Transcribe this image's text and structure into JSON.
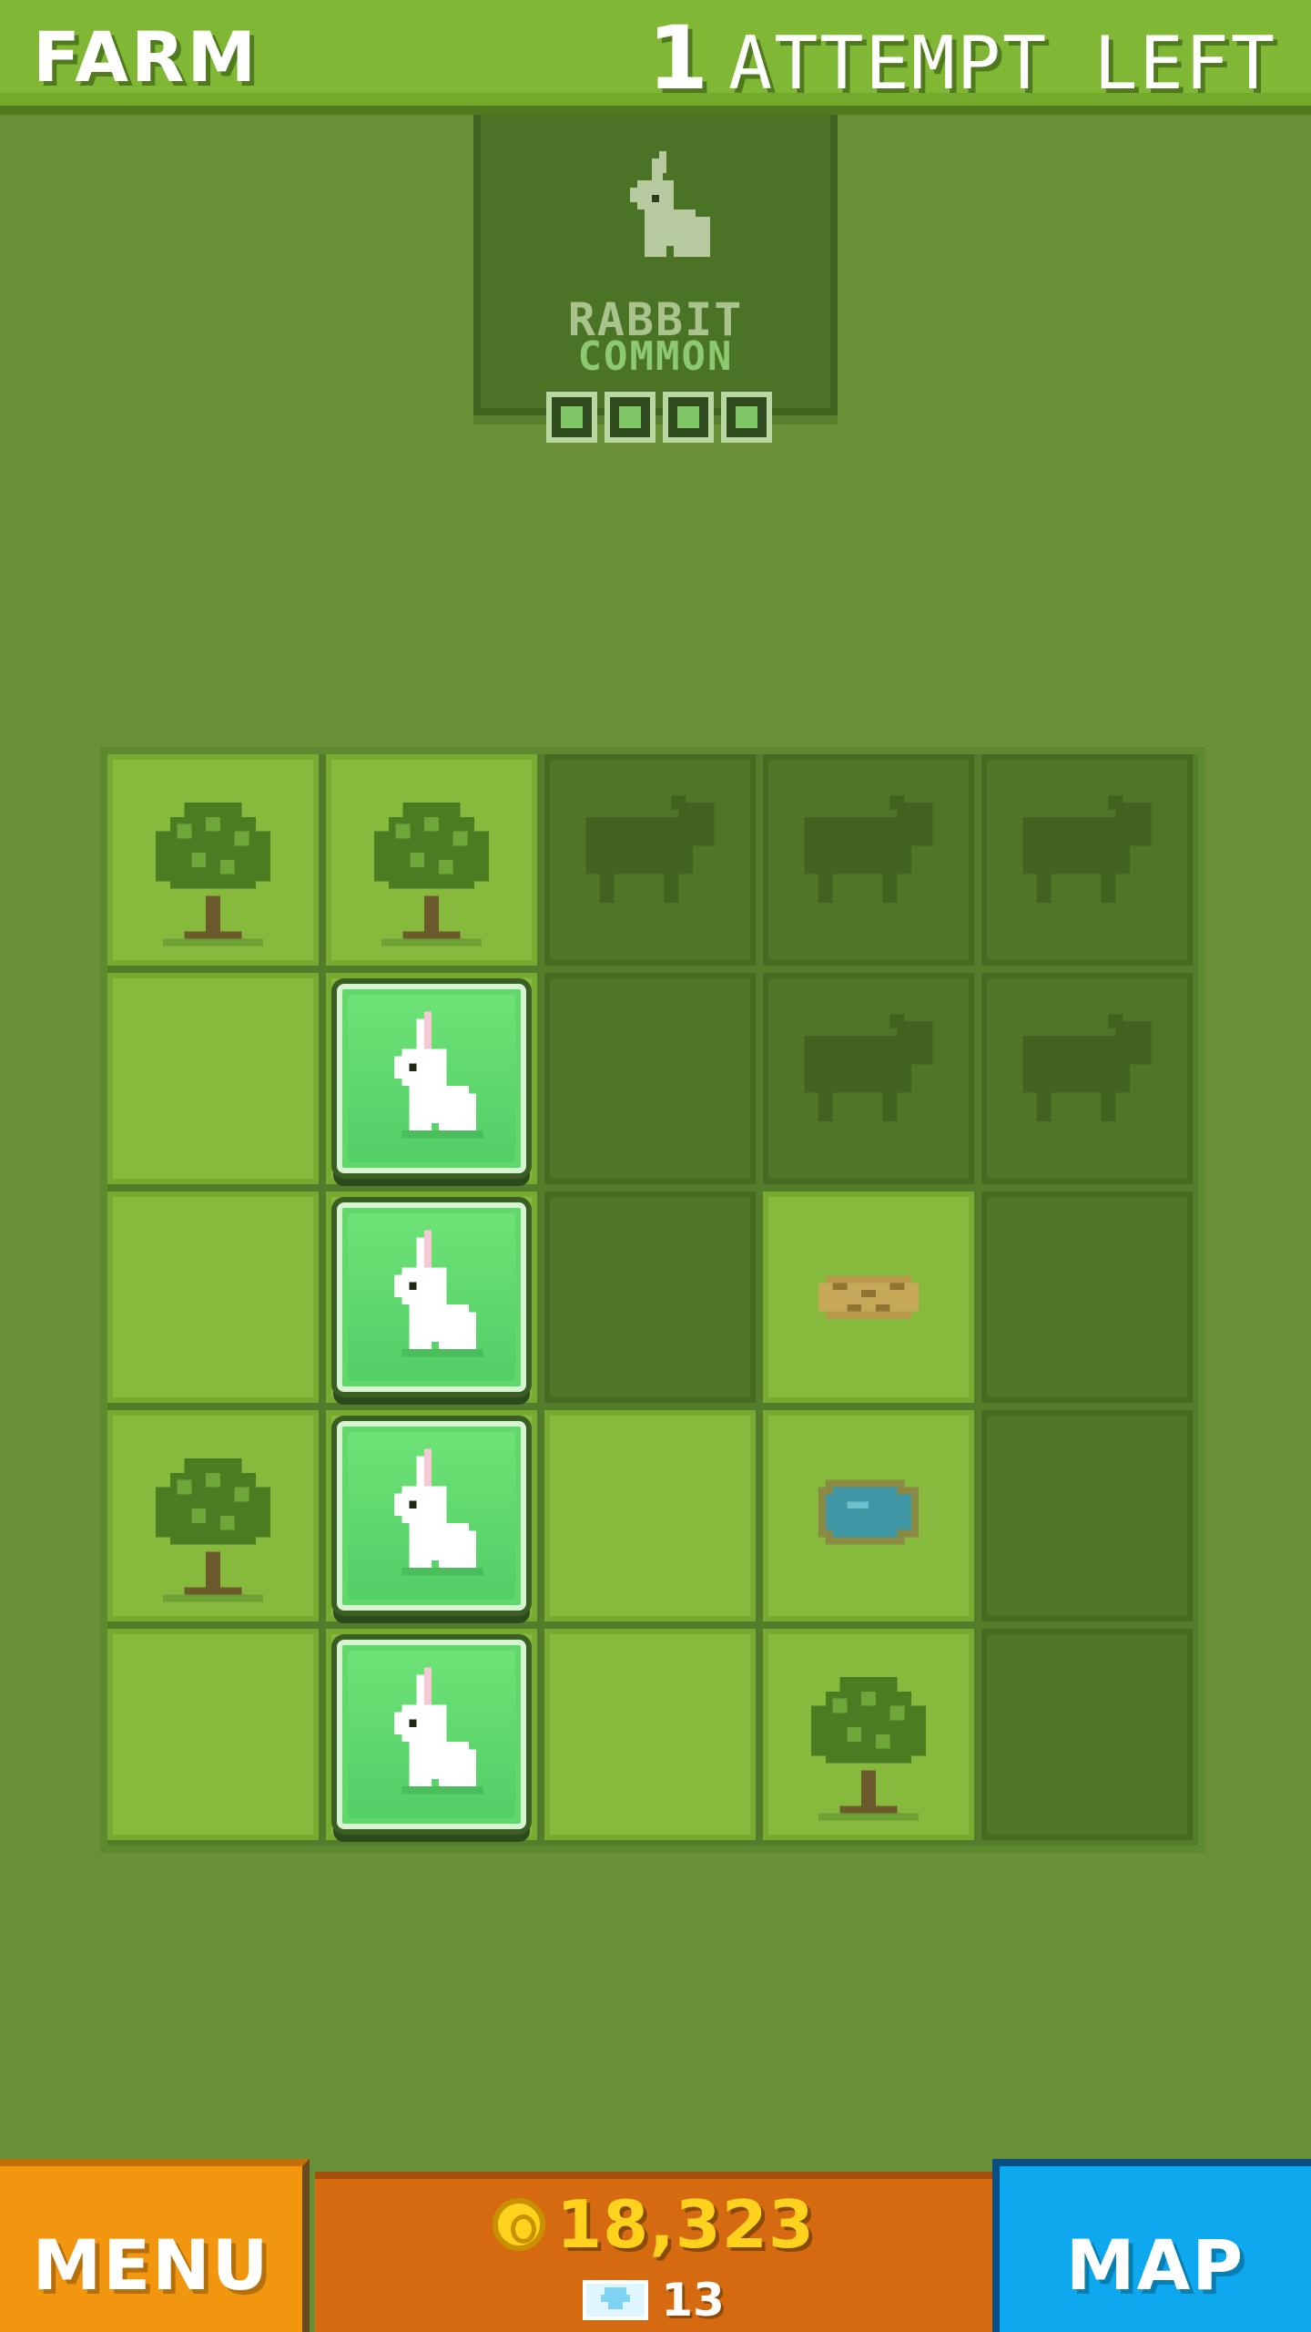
{
  "header": {
    "title": "FARM",
    "attempts_count": "1",
    "attempts_label": "ATTEMPT LEFT"
  },
  "card": {
    "animal": "RABBIT",
    "rarity": "COMMON",
    "icon": "rabbit-icon",
    "pips_filled": 4,
    "pips_total": 4
  },
  "board": {
    "rows": 5,
    "cols": 5,
    "cells": [
      [
        "tree",
        "tree",
        "cow-silhouette",
        "cow-silhouette",
        "cow-silhouette"
      ],
      [
        "grass",
        "rabbit",
        "dark",
        "cow-silhouette",
        "cow-silhouette"
      ],
      [
        "grass",
        "rabbit",
        "dark",
        "nest",
        "dark"
      ],
      [
        "tree",
        "rabbit",
        "grass",
        "pond",
        "dark"
      ],
      [
        "grass",
        "rabbit",
        "grass",
        "tree",
        "dark"
      ]
    ]
  },
  "bottom": {
    "menu_label": "MENU",
    "coins": "18,323",
    "gems": "13",
    "map_label": "MAP"
  },
  "colors": {
    "background": "#6a9038",
    "header": "#80b835",
    "menu": "#f2960f",
    "wallet": "#d66a10",
    "map": "#0da8ee",
    "coin": "#ffd21e",
    "tile": "#63d76b"
  }
}
